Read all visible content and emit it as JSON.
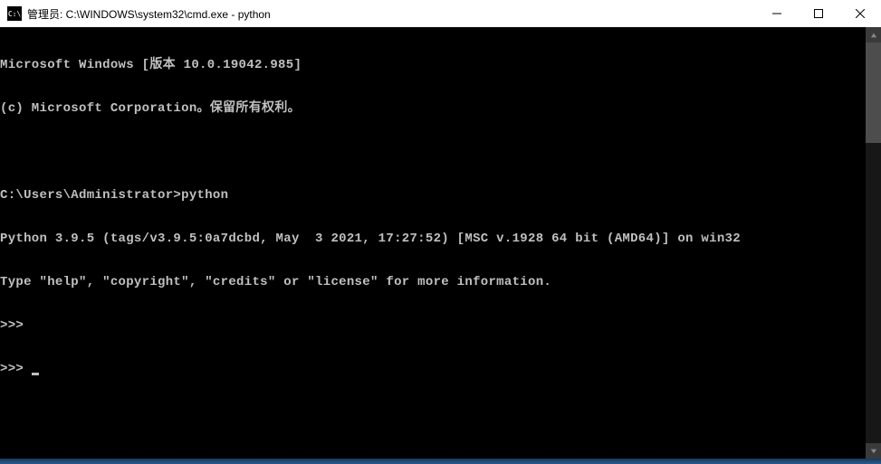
{
  "titlebar": {
    "icon_label": "C:\\",
    "title": "管理员: C:\\WINDOWS\\system32\\cmd.exe - python"
  },
  "terminal": {
    "line1": "Microsoft Windows [版本 10.0.19042.985]",
    "line2": "(c) Microsoft Corporation。保留所有权利。",
    "line3": "",
    "line4": "C:\\Users\\Administrator>python",
    "line5": "Python 3.9.5 (tags/v3.9.5:0a7dcbd, May  3 2021, 17:27:52) [MSC v.1928 64 bit (AMD64)] on win32",
    "line6": "Type \"help\", \"copyright\", \"credits\" or \"license\" for more information.",
    "line7": ">>>",
    "line8_prompt": ">>> "
  }
}
